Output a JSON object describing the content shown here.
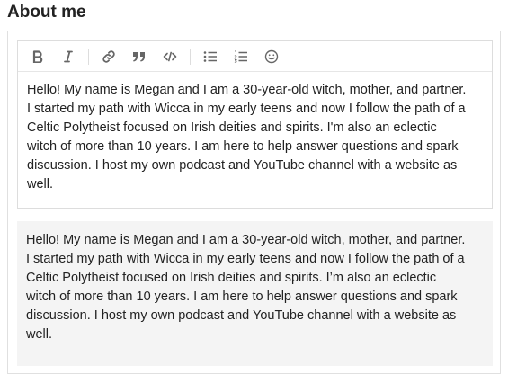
{
  "heading": "About me",
  "toolbar": {
    "buttons": [
      {
        "name": "bold",
        "icon": "bold-icon"
      },
      {
        "name": "italic",
        "icon": "italic-icon"
      },
      {
        "name": "link",
        "icon": "link-icon"
      },
      {
        "name": "quote",
        "icon": "quote-icon"
      },
      {
        "name": "code",
        "icon": "code-icon"
      },
      {
        "name": "bullet-list",
        "icon": "bullet-list-icon"
      },
      {
        "name": "numbered-list",
        "icon": "numbered-list-icon"
      },
      {
        "name": "emoji",
        "icon": "emoji-icon"
      }
    ]
  },
  "editor": {
    "text": "Hello! My name is Megan and I am a 30-year-old witch, mother, and partner.\nI started my path with Wicca in my early teens and now I follow the path of a\nCeltic Polytheist focused on Irish deities and spirits. I'm also an eclectic\nwitch of more than 10 years. I am here to help answer questions and spark\ndiscussion. I host my own podcast and YouTube channel with a website as\nwell."
  },
  "preview": {
    "text": "Hello! My name is Megan and I am a 30-year-old witch, mother, and partner.\nI started my path with Wicca in my early teens and now I follow the path of a\nCeltic Polytheist focused on Irish deities and spirits. I’m also an eclectic\nwitch of more than 10 years. I am here to help answer questions and spark\ndiscussion. I host my own podcast and YouTube channel with a website as\nwell."
  },
  "colors": {
    "icon": "#666666",
    "preview_bg": "#f4f4f4",
    "border": "#dddddd"
  }
}
